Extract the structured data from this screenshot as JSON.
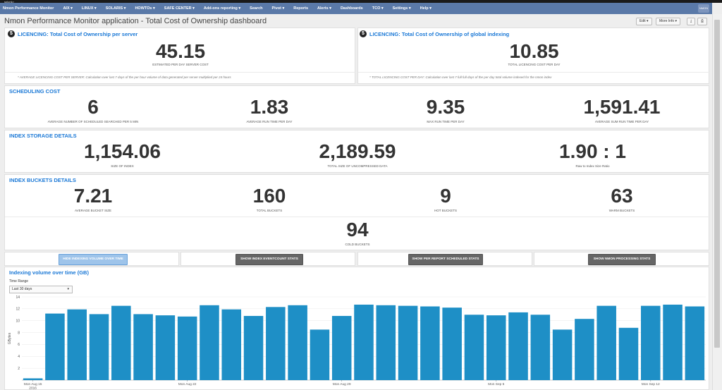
{
  "topbar": {
    "logo": "splunk>"
  },
  "nav": {
    "items": [
      "Nmon Performance Monitor",
      "AIX ▾",
      "LINUX ▾",
      "SOLARIS ▾",
      "HOWTOs ▾",
      "SAFE CENTER ▾",
      "Add-ons reporting ▾",
      "Search",
      "Pivot ▾",
      "Reports",
      "Alerts ▾",
      "Dashboards",
      "TCO ▾",
      "Settings ▾",
      "Help ▾"
    ],
    "logo": "NMON"
  },
  "page": {
    "title": "Nmon Performance Monitor application - Total Cost of Ownership dashboard",
    "edit_label": "Edit ▾",
    "more_info_label": "More Info ▾",
    "export_icon": "⤓",
    "print_icon": "⎙"
  },
  "licencing_server": {
    "title": "LICENCING: Total Cost of Ownership per server",
    "value": "45.15",
    "label": "ESTIMATED PER DAY SERVER COST",
    "note": "* AVERAGE LICENCING COST PER SERVER: Calculation over last 7 days of the per hour volume of data generated per server multiplied per 24 hours"
  },
  "licencing_global": {
    "title": "LICENCING: Total Cost of Ownership of global indexing",
    "value": "10.85",
    "label": "TOTAL LICENCING COST PER DAY",
    "note": "* TOTAL LICENCING COST PER DAY: Calculation over last 7 full full days of the per day total volume indexed for the nmon index"
  },
  "scheduling": {
    "title": "SCHEDULING COST",
    "stats": [
      {
        "value": "6",
        "label": "AVERAGE NUMBER OF SCHEDULED SEARCHED PER 5 MIN"
      },
      {
        "value": "1.83",
        "label": "AVERAGE RUN TIME PER DAY"
      },
      {
        "value": "9.35",
        "label": "MAX RUN TIME PER DAY"
      },
      {
        "value": "1,591.41",
        "label": "AVERAGE SUM RUN TIME PER DAY"
      }
    ]
  },
  "storage": {
    "title": "INDEX STORAGE DETAILS",
    "stats": [
      {
        "value": "1,154.06",
        "label": "SIZE OF INDEX"
      },
      {
        "value": "2,189.59",
        "label": "TOTAL SIZE OF UNCOMPRESSED DATA"
      },
      {
        "value": "1.90 : 1",
        "label": "Raw to Index Size Ratio"
      }
    ]
  },
  "buckets": {
    "title": "INDEX BUCKETS DETAILS",
    "stats": [
      {
        "value": "7.21",
        "label": "AVERAGE BUCKET SIZE"
      },
      {
        "value": "160",
        "label": "TOTAL BUCKETS"
      },
      {
        "value": "9",
        "label": "HOT BUCKETS"
      },
      {
        "value": "63",
        "label": "WARM BUCKETS"
      },
      {
        "value": "94",
        "label": "COLD BUCKETS"
      }
    ]
  },
  "buttons": {
    "hide_indexing": "HIDE INDEXING VOLUME OVER TIME",
    "show_eventcount": "SHOW INDEX EVENTCOUNT STATS",
    "show_scheduled": "SHOW PER REPORT SCHEDULED STATS",
    "show_processing": "SHOW NMON PROCESSING STATS"
  },
  "time_range": {
    "label": "Time Range",
    "value": "Last 30 days"
  },
  "chart_data": {
    "type": "bar",
    "title": "Indexing volume over time (GB)",
    "ylabel": "GBytes",
    "ylim": [
      0,
      14
    ],
    "yticks": [
      2,
      4,
      6,
      8,
      10,
      12,
      14
    ],
    "color": "#1e8fc6",
    "x_tick_labels": [
      {
        "index": 0,
        "label": "Mon Aug 15",
        "sub": "2016"
      },
      {
        "index": 7,
        "label": "Mon Aug 22",
        "sub": ""
      },
      {
        "index": 14,
        "label": "Mon Aug 29",
        "sub": ""
      },
      {
        "index": 21,
        "label": "Mon Sep 5",
        "sub": ""
      },
      {
        "index": 28,
        "label": "Mon Sep 12",
        "sub": ""
      }
    ],
    "values": [
      0.3,
      11.2,
      11.9,
      11.1,
      12.5,
      11.1,
      10.9,
      10.7,
      12.6,
      11.9,
      10.8,
      12.3,
      12.6,
      8.5,
      10.8,
      12.7,
      12.6,
      12.5,
      12.4,
      12.2,
      11.0,
      10.9,
      11.4,
      11.0,
      8.5,
      10.3,
      12.5,
      8.8,
      12.5,
      12.7,
      12.4
    ]
  }
}
